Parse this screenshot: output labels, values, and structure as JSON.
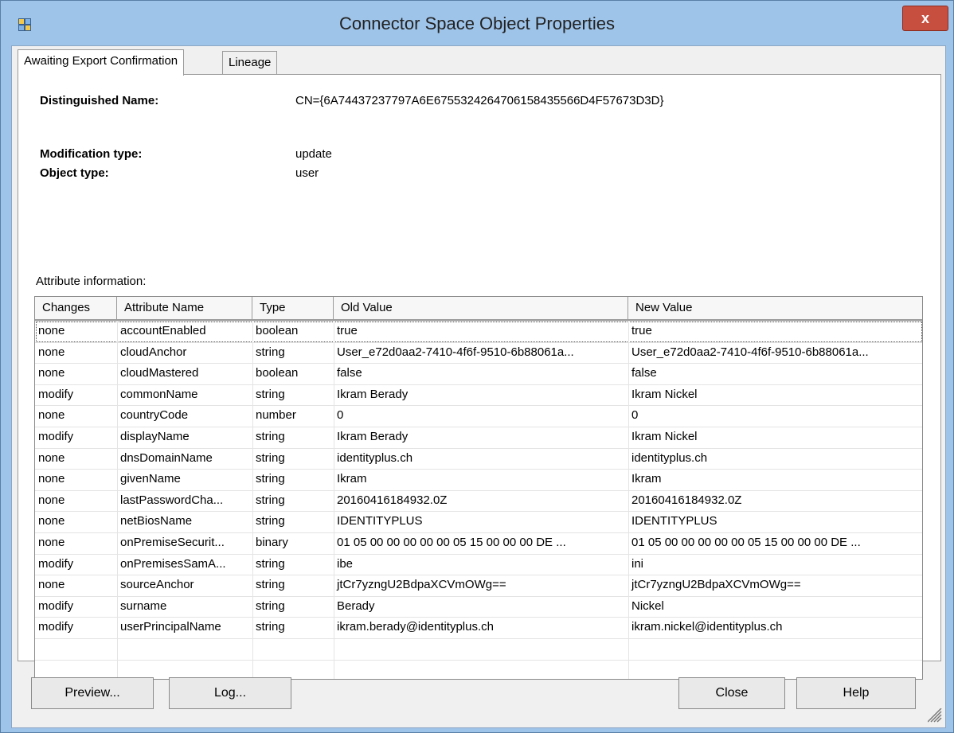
{
  "window": {
    "title": "Connector Space Object Properties",
    "close_glyph": "x"
  },
  "tabs": [
    {
      "label": "Awaiting Export Confirmation",
      "active": true
    },
    {
      "label": "Lineage",
      "active": false
    }
  ],
  "details": {
    "dn_label": "Distinguished Name:",
    "dn_value": "CN={6A74437237797A6E6755324264706158435566D4F57673D3D}",
    "mod_label": "Modification type:",
    "mod_value": "update",
    "obj_label": "Object type:",
    "obj_value": "user",
    "attr_label": "Attribute information:"
  },
  "table": {
    "columns": [
      "Changes",
      "Attribute Name",
      "Type",
      "Old Value",
      "New Value"
    ],
    "rows": [
      [
        "none",
        "accountEnabled",
        "boolean",
        "true",
        "true"
      ],
      [
        "none",
        "cloudAnchor",
        "string",
        "User_e72d0aa2-7410-4f6f-9510-6b88061a...",
        "User_e72d0aa2-7410-4f6f-9510-6b88061a..."
      ],
      [
        "none",
        "cloudMastered",
        "boolean",
        "false",
        "false"
      ],
      [
        "modify",
        "commonName",
        "string",
        "Ikram Berady",
        "Ikram Nickel"
      ],
      [
        "none",
        "countryCode",
        "number",
        "0",
        "0"
      ],
      [
        "modify",
        "displayName",
        "string",
        "Ikram Berady",
        "Ikram Nickel"
      ],
      [
        "none",
        "dnsDomainName",
        "string",
        "identityplus.ch",
        "identityplus.ch"
      ],
      [
        "none",
        "givenName",
        "string",
        "Ikram",
        "Ikram"
      ],
      [
        "none",
        "lastPasswordCha...",
        "string",
        "20160416184932.0Z",
        "20160416184932.0Z"
      ],
      [
        "none",
        "netBiosName",
        "string",
        "IDENTITYPLUS",
        "IDENTITYPLUS"
      ],
      [
        "none",
        "onPremiseSecurit...",
        "binary",
        "01 05 00 00 00 00 00 05 15 00 00 00 DE ...",
        "01 05 00 00 00 00 00 05 15 00 00 00 DE ..."
      ],
      [
        "modify",
        "onPremisesSamA...",
        "string",
        "ibe",
        "ini"
      ],
      [
        "none",
        "sourceAnchor",
        "string",
        "jtCr7yzngU2BdpaXCVmOWg==",
        "jtCr7yzngU2BdpaXCVmOWg=="
      ],
      [
        "modify",
        "surname",
        "string",
        "Berady",
        "Nickel"
      ],
      [
        "modify",
        "userPrincipalName",
        "string",
        "ikram.berady@identityplus.ch",
        "ikram.nickel@identityplus.ch"
      ]
    ]
  },
  "buttons": {
    "preview": "Preview...",
    "log": "Log...",
    "close": "Close",
    "help": "Help"
  },
  "icons": {
    "app": "connector-space-icon",
    "grip": "resize-grip-icon"
  }
}
